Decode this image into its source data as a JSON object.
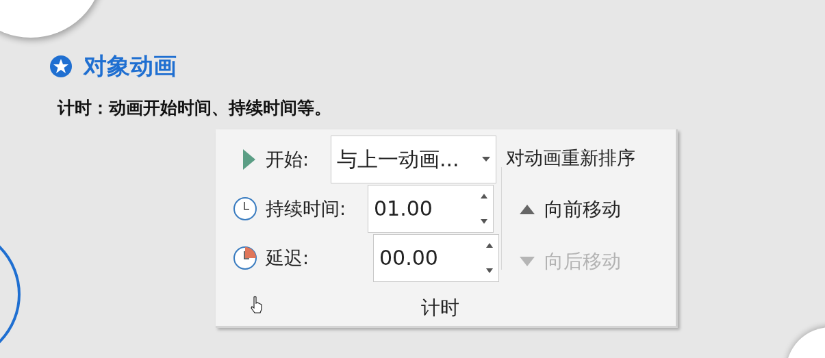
{
  "heading": {
    "text": "对象动画"
  },
  "description": "计时：动画开始时间、持续时间等。",
  "timing_panel": {
    "rows": [
      {
        "kind": "dropdown",
        "label": "开始:",
        "value": "与上一动画..."
      },
      {
        "kind": "spinner",
        "label": "持续时间:",
        "value": "01.00"
      },
      {
        "kind": "spinner",
        "label": "延迟:",
        "value": "00.00"
      }
    ],
    "reorder": {
      "title": "对动画重新排序",
      "buttons": [
        {
          "kind": "up",
          "label": "向前移动",
          "disabled": false
        },
        {
          "kind": "down",
          "label": "向后移动",
          "disabled": true
        }
      ]
    },
    "group_label": "计时"
  }
}
